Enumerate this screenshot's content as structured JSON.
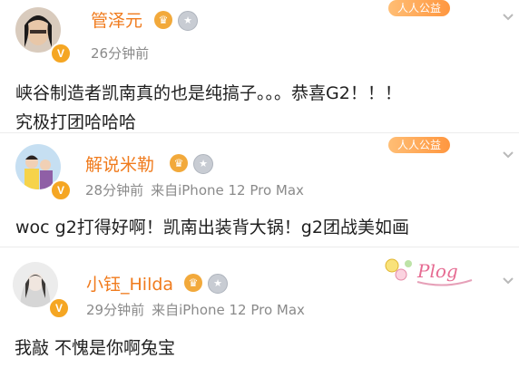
{
  "comments": [
    {
      "username": "管泽元",
      "time": "26分钟前",
      "source": "",
      "content_lines": [
        "峡谷制造者凯南真的也是纯搞子。。。恭喜G2！！！",
        "究极打团哈哈哈"
      ],
      "banner": "人人公益"
    },
    {
      "username": "解说米勒",
      "time": "28分钟前",
      "source": "来自iPhone 12 Pro Max",
      "content": "woc g2打得好啊！凯南出装背大锅！g2团战美如画",
      "banner": "人人公益"
    },
    {
      "username": "小钰_Hilda",
      "time": "29分钟前",
      "source": "来自iPhone 12 Pro Max",
      "content": "我敲 不愧是你啊兔宝",
      "decoration": "Plog"
    }
  ],
  "icons": {
    "verified": "verified-v-icon",
    "crown": "crown-icon",
    "medal": "medal-icon",
    "chevron": "chevron-down-icon"
  },
  "colors": {
    "username": "#f07b1d",
    "meta": "#8a8a8a",
    "text": "#1f1f1f",
    "badge": "#f5a623"
  }
}
